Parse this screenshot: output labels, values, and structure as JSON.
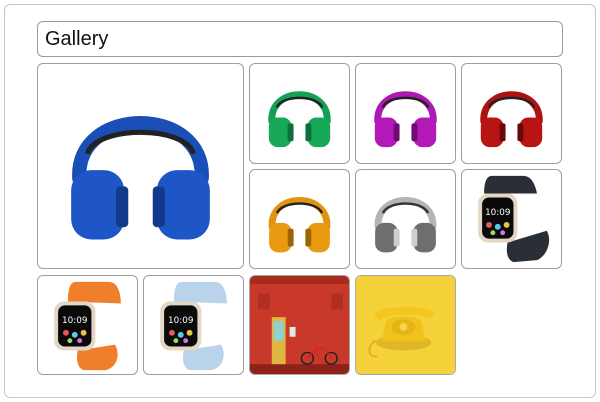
{
  "gallery": {
    "title": "Gallery",
    "items": [
      {
        "id": "blue-headphones",
        "icon": "headphones-icon",
        "color": "#1e56c8"
      },
      {
        "id": "green-headphones",
        "icon": "headphones-icon",
        "color": "#18a85a"
      },
      {
        "id": "magenta-headphones",
        "icon": "headphones-icon",
        "color": "#b318b8"
      },
      {
        "id": "red-headphones",
        "icon": "headphones-icon",
        "color": "#b81414"
      },
      {
        "id": "orange-headphones",
        "icon": "headphones-icon",
        "color": "#e89a10"
      },
      {
        "id": "silver-headphones",
        "icon": "headphones-icon",
        "color": "#9e9e9e"
      },
      {
        "id": "black-watch",
        "icon": "smartwatch-icon",
        "color": "#2a2f36",
        "time": "10:09"
      },
      {
        "id": "orange-watch",
        "icon": "smartwatch-icon",
        "color": "#f07e2a",
        "time": "10:09"
      },
      {
        "id": "lightblue-watch",
        "icon": "smartwatch-icon",
        "color": "#b9d3ea",
        "time": "10:09"
      },
      {
        "id": "red-wall-photo",
        "icon": "red-wall-bicycle-photo",
        "color": "#c8392a"
      },
      {
        "id": "yellow-phone-photo",
        "icon": "yellow-telephone-photo",
        "color": "#f6d23a"
      }
    ]
  }
}
